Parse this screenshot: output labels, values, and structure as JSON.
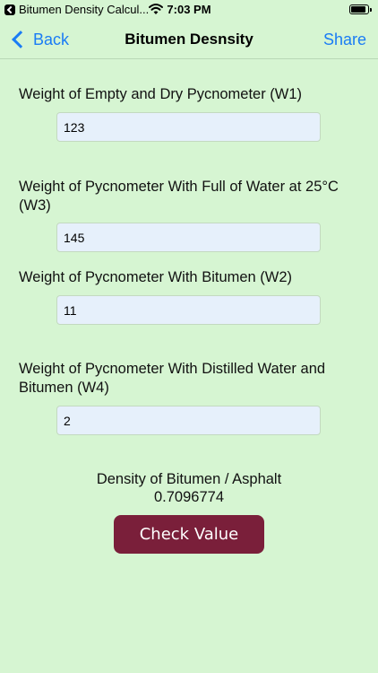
{
  "status_bar": {
    "app_name": "Bitumen Density Calcul...",
    "time": "7:03 PM",
    "icons": [
      "back-to-app-icon",
      "wifi-icon",
      "battery-icon"
    ]
  },
  "nav": {
    "back_label": "Back",
    "title": "Bitumen Desnsity",
    "share_label": "Share"
  },
  "form": {
    "fields": [
      {
        "label": "Weight of Empty and Dry Pycnometer (W1)",
        "value": "123"
      },
      {
        "label": "Weight of Pycnometer With Full of Water at 25°C (W3)",
        "value": "145"
      },
      {
        "label": "Weight of Pycnometer With Bitumen (W2)",
        "value": "11"
      },
      {
        "label": "Weight of Pycnometer With Distilled Water and Bitumen (W4)",
        "value": "2"
      }
    ]
  },
  "result": {
    "label": "Density of Bitumen / Asphalt",
    "value": "0.7096774"
  },
  "check_button_label": "Check Value",
  "colors": {
    "background": "#d6f5d2",
    "accent": "#1a7cf5",
    "button": "#7a1f3a",
    "input_bg": "#e6f0fb"
  }
}
